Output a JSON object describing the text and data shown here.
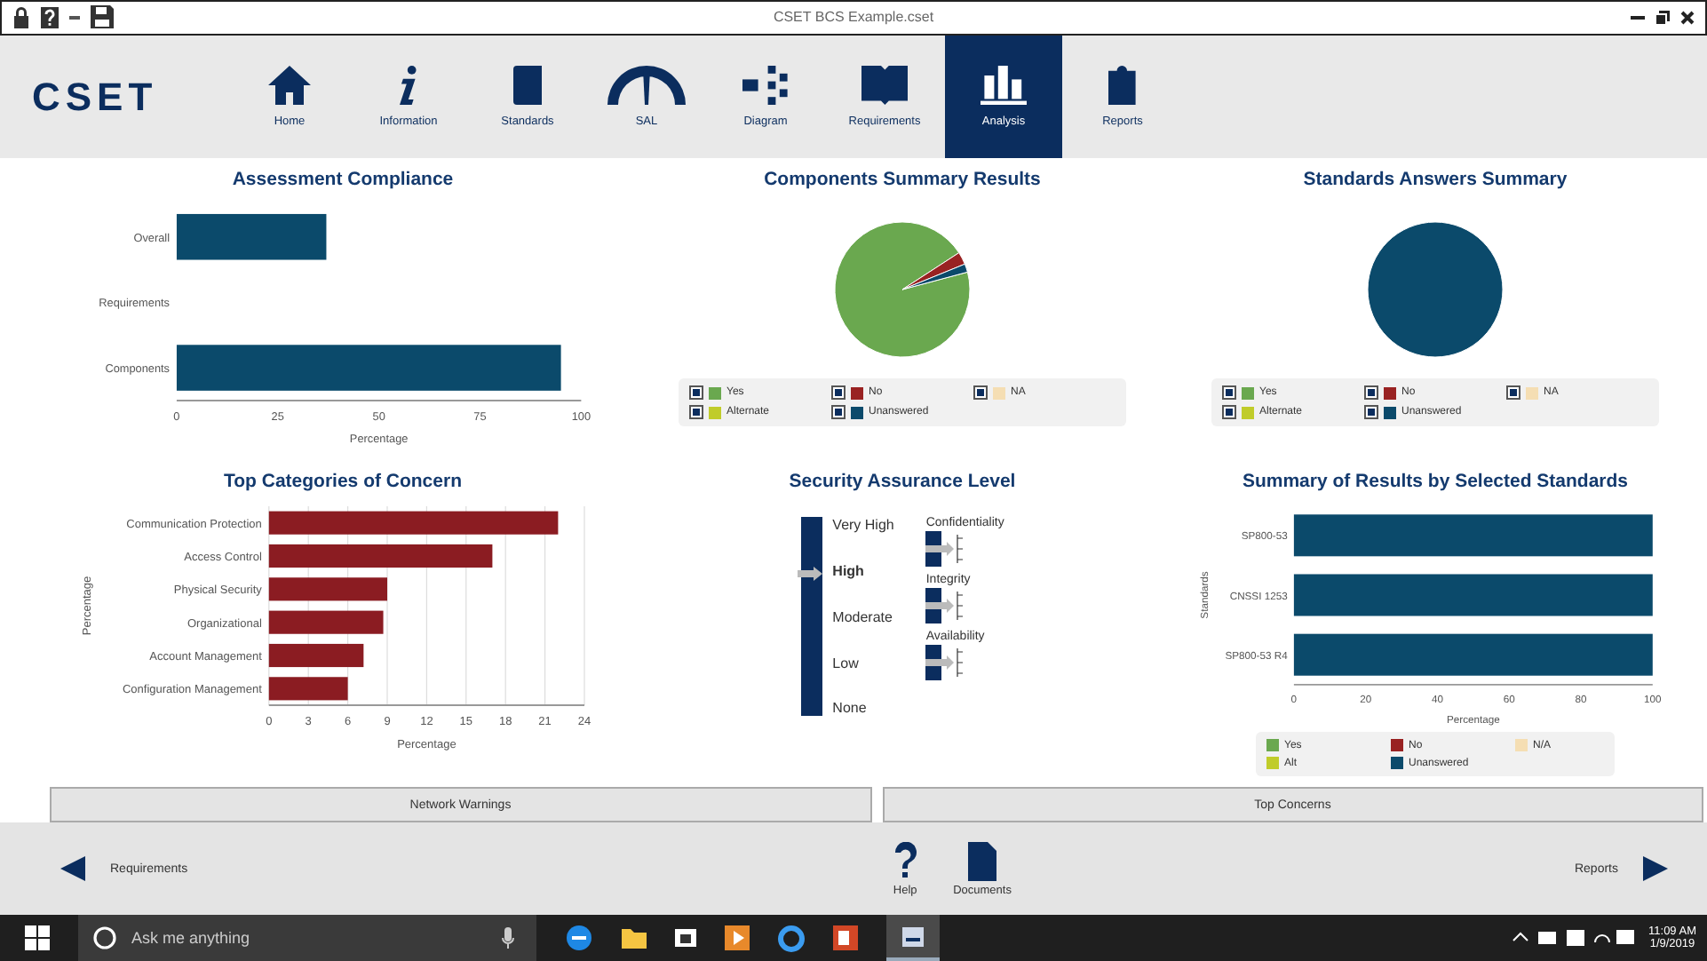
{
  "window": {
    "title": "CSET BCS Example.cset"
  },
  "toolbar": {
    "logo": "CSET",
    "items": [
      {
        "label": "Home",
        "selected": false
      },
      {
        "label": "Information",
        "selected": false
      },
      {
        "label": "Standards",
        "selected": false
      },
      {
        "label": "SAL",
        "selected": false
      },
      {
        "label": "Diagram",
        "selected": false
      },
      {
        "label": "Requirements",
        "selected": false
      },
      {
        "label": "Analysis",
        "selected": true
      },
      {
        "label": "Reports",
        "selected": false
      }
    ]
  },
  "panels": [
    {
      "kind": "chart",
      "title": "Assessment Compliance",
      "chart_data": {
        "type": "bar",
        "orientation": "horizontal",
        "xlabel": "Percentage",
        "categories": [
          "Overall",
          "Requirements",
          "Components"
        ],
        "series": [
          {
            "color": "#0b4a6b",
            "values": [
              37,
              null,
              95
            ]
          }
        ],
        "xlim": [
          0,
          100
        ],
        "xticks": [
          0,
          25,
          50,
          75,
          100
        ]
      }
    },
    {
      "kind": "chart",
      "title": "Components Summary Results",
      "chart_data": {
        "type": "pie",
        "categories": [
          "Yes",
          "No",
          "NA",
          "Alternate",
          "Unanswered"
        ],
        "values": [
          95,
          3,
          0,
          0,
          2
        ],
        "colors": [
          "#6aa84f",
          "#992222",
          "#f5deb3",
          "#c0cc2a",
          "#0b4a6b"
        ]
      }
    },
    {
      "kind": "chart",
      "title": "Standards Answers Summary",
      "chart_data": {
        "type": "pie",
        "categories": [
          "Yes",
          "No",
          "NA",
          "Alternate",
          "Unanswered"
        ],
        "values": [
          0,
          0,
          0,
          0,
          100
        ],
        "colors": [
          "#6aa84f",
          "#992222",
          "#f5deb3",
          "#c0cc2a",
          "#0b4a6b"
        ]
      }
    },
    {
      "kind": "chart",
      "title": "Top Categories of Concern",
      "chart_data": {
        "type": "bar",
        "orientation": "horizontal",
        "grid": true,
        "xlabel": "Percentage",
        "ylabel": "Percentage",
        "categories": [
          "Communication Protection",
          "Access Control",
          "Physical Security",
          "Organizational",
          "Account Management",
          "Configuration Management"
        ],
        "series": [
          {
            "color": "#8b1c22",
            "values": [
              22,
              17,
              9,
              8.7,
              7.2,
              6
            ]
          }
        ],
        "xlim": [
          0,
          24
        ],
        "xticks": [
          0,
          3,
          6,
          9,
          12,
          15,
          18,
          21,
          24
        ]
      }
    },
    {
      "kind": "sal",
      "title": "Security Assurance Level",
      "levels": [
        {
          "label": "Very High",
          "selected": false
        },
        {
          "label": "High",
          "selected": true
        },
        {
          "label": "Moderate",
          "selected": false
        },
        {
          "label": "Low",
          "selected": false
        },
        {
          "label": "None",
          "selected": false
        }
      ],
      "objectives": [
        {
          "label": "Confidentiality"
        },
        {
          "label": "Integrity"
        },
        {
          "label": "Availability"
        }
      ]
    },
    {
      "kind": "chart",
      "title": "Summary of Results by Selected Standards",
      "chart_data": {
        "type": "bar",
        "orientation": "horizontal",
        "stacked": true,
        "xlabel": "Percentage",
        "ylabel": "Standards",
        "categories": [
          "SP800-53",
          "CNSSI 1253",
          "SP800-53 R4"
        ],
        "series": [
          {
            "name": "Yes",
            "color": "#6aa84f",
            "values": [
              0,
              0,
              0
            ]
          },
          {
            "name": "No",
            "color": "#992222",
            "values": [
              0,
              0,
              0
            ]
          },
          {
            "name": "N/A",
            "color": "#f5deb3",
            "values": [
              0,
              0,
              0
            ]
          },
          {
            "name": "Alt",
            "color": "#c0cc2a",
            "values": [
              0,
              0,
              0
            ]
          },
          {
            "name": "Unanswered",
            "color": "#0b4a6b",
            "values": [
              100,
              100,
              100
            ]
          }
        ],
        "xlim": [
          0,
          100
        ],
        "xticks": [
          0,
          20,
          40,
          60,
          80,
          100
        ]
      }
    }
  ],
  "report_buttons": [
    "Network Warnings",
    "Top Concerns"
  ],
  "bottom_nav": {
    "back": "Requirements",
    "help": "Help",
    "documents": "Documents",
    "next": "Reports"
  },
  "taskbar": {
    "search_placeholder": "Ask me anything",
    "time": "11:09 AM",
    "date": "1/9/2019"
  }
}
